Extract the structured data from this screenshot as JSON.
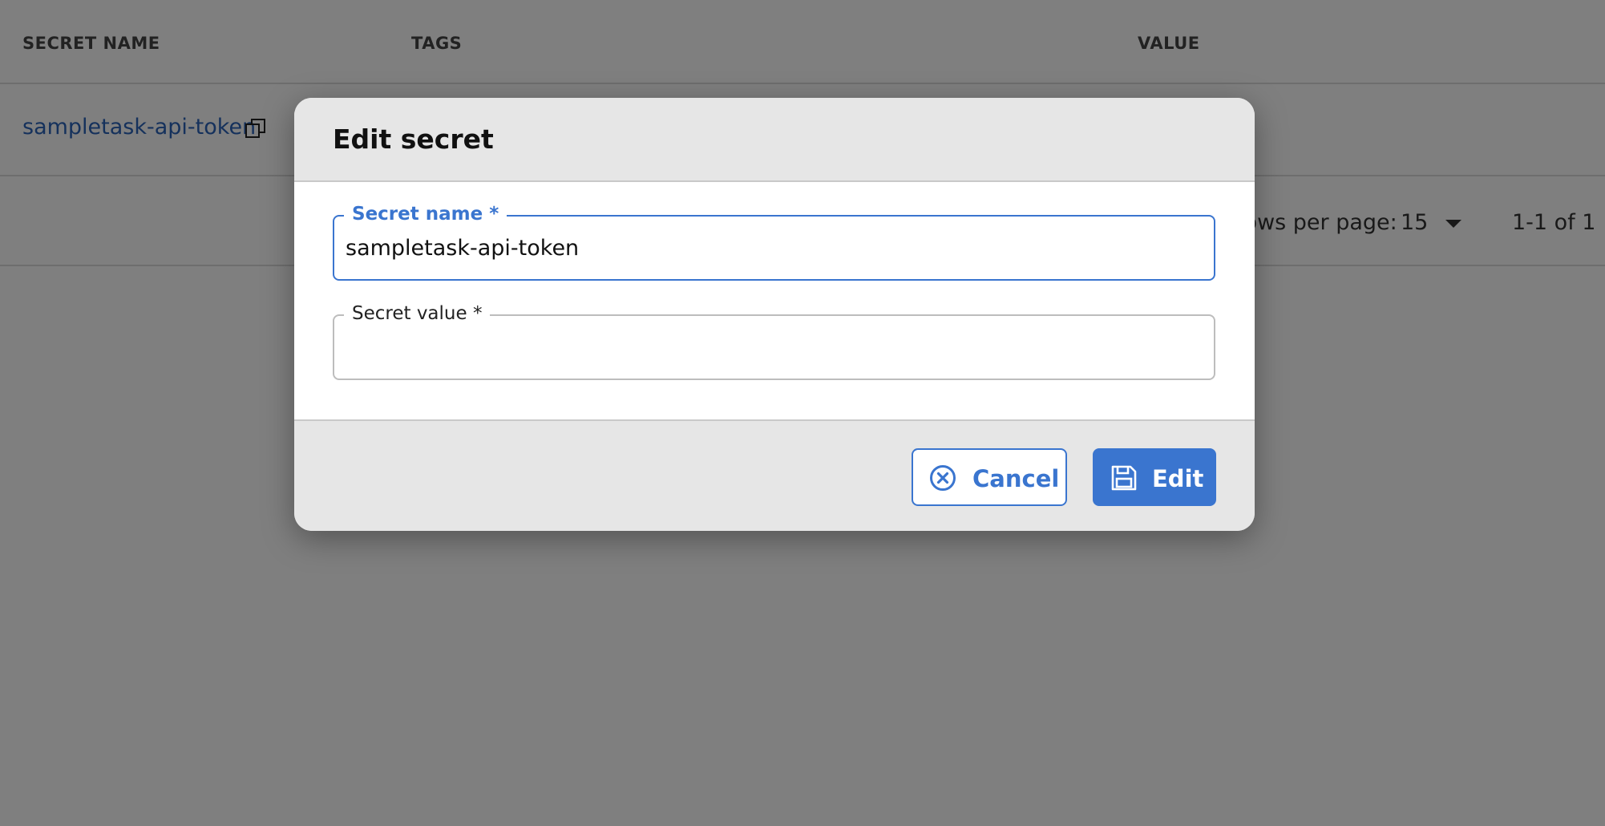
{
  "table": {
    "columns": [
      "SECRET NAME",
      "TAGS",
      "VALUE"
    ],
    "rows": [
      {
        "secret_name": "sampletask-api-token"
      }
    ],
    "pagination": {
      "rows_per_page_label": "Rows per page:",
      "rows_per_page_value": "15",
      "range": "1-1 of 1"
    }
  },
  "dialog": {
    "title": "Edit secret",
    "fields": {
      "secret_name": {
        "label": "Secret name *",
        "value": "sampletask-api-token"
      },
      "secret_value": {
        "label": "Secret value *",
        "value": ""
      }
    },
    "buttons": {
      "cancel": "Cancel",
      "edit": "Edit"
    }
  },
  "icons": {
    "copy": "copy-icon",
    "caret": "chevron-down-icon",
    "cancel": "cancel-circle-icon",
    "save": "save-icon"
  },
  "colors": {
    "accent": "#3a75cf",
    "link": "#2a63b8",
    "overlay": "rgba(0,0,0,0.5)",
    "dialog_band": "#e6e6e6"
  }
}
